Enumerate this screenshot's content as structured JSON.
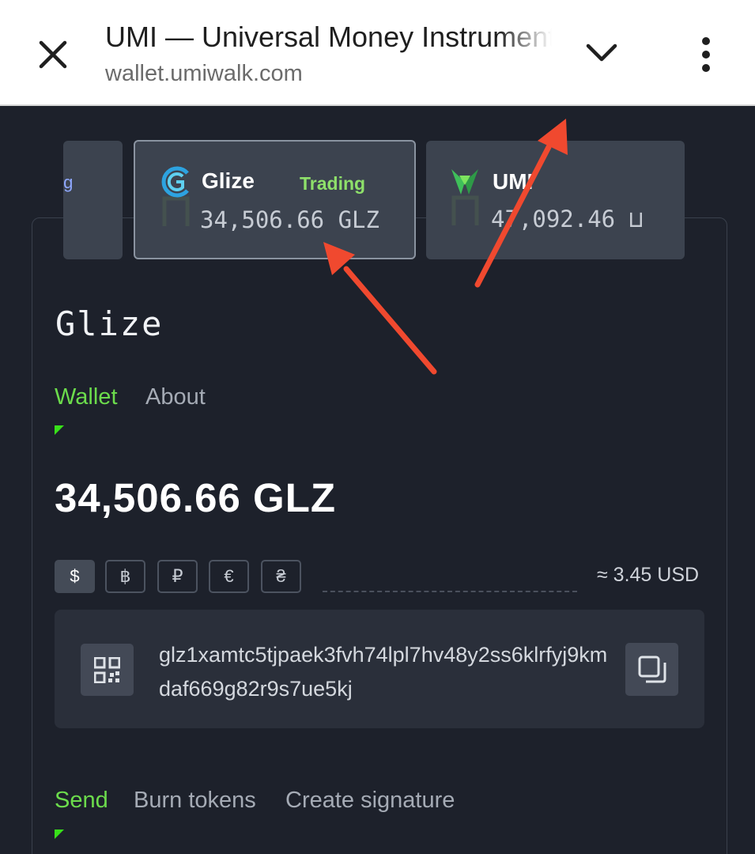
{
  "browser": {
    "title": "UMI — Universal Money Instrument",
    "url": "wallet.umiwalk.com",
    "close_icon": "close-icon",
    "chevron_icon": "chevron-down-icon",
    "menu_icon": "more-vert-icon"
  },
  "tokens": [
    {
      "partial_label": "ıg"
    },
    {
      "name": "Glize",
      "tag": "Trading",
      "balance": "34,506.66 GLZ",
      "logo": "glize-logo-icon"
    },
    {
      "name": "UMI",
      "balance": "47,092.46 ⊔",
      "logo": "umi-logo-icon"
    }
  ],
  "page": {
    "title": "Glize",
    "tabs": [
      "Wallet",
      "About"
    ],
    "balance": "34,506.66 GLZ",
    "currencies": [
      "$",
      "฿",
      "₽",
      "€",
      "₴"
    ],
    "active_currency": "$",
    "approx": "≈ 3.45 USD",
    "address": "glz1xamtc5tjpaek3fvh74lpl7hv48y2ss6klrfyj9kmdaf669g82r9s7ue5kj",
    "qr_icon": "qr-code-icon",
    "copy_icon": "copy-icon",
    "action_tabs": [
      "Send",
      "Burn tokens",
      "Create signature"
    ]
  },
  "colors": {
    "accent_green": "#6cdc4c",
    "annotation_red": "#f0492f",
    "background": "#1d212b"
  }
}
